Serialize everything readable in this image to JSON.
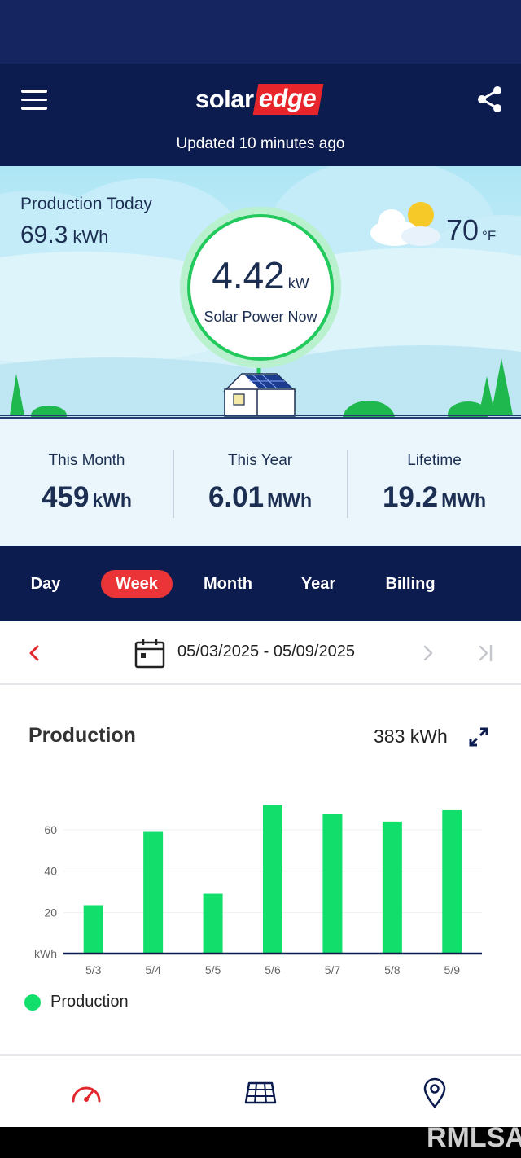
{
  "header": {
    "logo_part1": "solar",
    "logo_part2": "edge",
    "updated_text": "Updated 10 minutes ago"
  },
  "hero": {
    "production_today_label": "Production Today",
    "production_today_value": "69.3",
    "production_today_unit": "kWh",
    "power_value": "4.42",
    "power_unit": "kW",
    "power_label": "Solar Power Now",
    "temperature_value": "70",
    "temperature_unit": "°F",
    "weather_icon": "partly-cloudy-icon"
  },
  "stats": [
    {
      "label": "This Month",
      "value": "459",
      "unit": "kWh"
    },
    {
      "label": "This Year",
      "value": "6.01",
      "unit": "MWh"
    },
    {
      "label": "Lifetime",
      "value": "19.2",
      "unit": "MWh"
    }
  ],
  "tabs": [
    {
      "label": "Day"
    },
    {
      "label": "Week",
      "active": true
    },
    {
      "label": "Month"
    },
    {
      "label": "Year"
    },
    {
      "label": "Billing"
    }
  ],
  "date_nav": {
    "range": "05/03/2025 - 05/09/2025"
  },
  "production_card": {
    "title": "Production",
    "total": "383 kWh"
  },
  "chart_data": {
    "type": "bar",
    "categories": [
      "5/3",
      "5/4",
      "5/5",
      "5/6",
      "5/7",
      "5/8",
      "5/9"
    ],
    "series": [
      {
        "name": "Production",
        "values": [
          23.5,
          59,
          29,
          72,
          67.5,
          64,
          69.5
        ]
      }
    ],
    "ylabel": "kWh",
    "yticks": [
      20,
      40,
      60
    ],
    "ylim": [
      0,
      75
    ],
    "grid": true,
    "legend": "bottom-left",
    "legend_label": "Production",
    "color": "#12de6b"
  },
  "colors": {
    "navy": "#0d1c4f",
    "accent_red": "#ea3438",
    "green": "#12de6b"
  },
  "bottom_nav": {
    "items": [
      "dashboard-icon",
      "solar-panel-icon",
      "location-icon"
    ]
  },
  "watermark": "RMLSA"
}
